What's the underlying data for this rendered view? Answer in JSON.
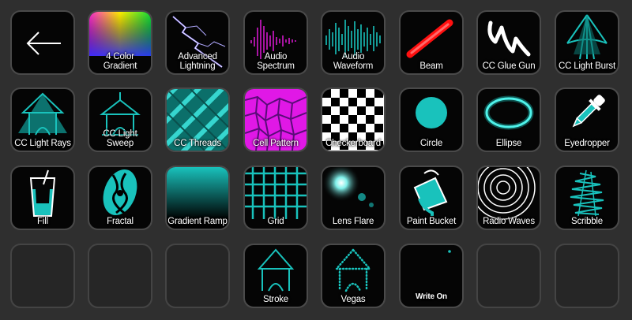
{
  "colors": {
    "accent": "#19c2bc",
    "background": "#2f2f2f",
    "key": "#050505",
    "blank": "#262626"
  },
  "keys": {
    "back": {
      "icon": "arrow-left-icon"
    },
    "four_color_gradient": {
      "label": "4 Color\nGradient"
    },
    "advanced_lightning": {
      "label": "Advanced\nLightning"
    },
    "audio_spectrum": {
      "label": "Audio\nSpectrum"
    },
    "audio_waveform": {
      "label": "Audio\nWaveform"
    },
    "beam": {
      "label": "Beam"
    },
    "cc_glue_gun": {
      "label": "CC Glue Gun"
    },
    "cc_light_burst": {
      "label": "CC Light Burst"
    },
    "cc_light_rays": {
      "label": "CC Light Rays"
    },
    "cc_light_sweep": {
      "label": "CC Light Sweep"
    },
    "cc_threads": {
      "label": "CC Threads"
    },
    "cell_pattern": {
      "label": "Cell Pattern"
    },
    "checkerboard": {
      "label": "Checkerboard"
    },
    "circle": {
      "label": "Circle"
    },
    "ellipse": {
      "label": "Ellipse"
    },
    "eyedropper": {
      "label": "Eyedropper"
    },
    "fill": {
      "label": "Fill"
    },
    "fractal": {
      "label": "Fractal"
    },
    "gradient_ramp": {
      "label": "Gradient Ramp"
    },
    "grid": {
      "label": "Grid"
    },
    "lens_flare": {
      "label": "Lens Flare"
    },
    "paint_bucket": {
      "label": "Paint Bucket"
    },
    "radio_waves": {
      "label": "Radio Waves"
    },
    "scribble": {
      "label": "Scribble"
    },
    "stroke": {
      "label": "Stroke"
    },
    "vegas": {
      "label": "Vegas"
    },
    "write_on": {
      "label": "Write On"
    }
  }
}
